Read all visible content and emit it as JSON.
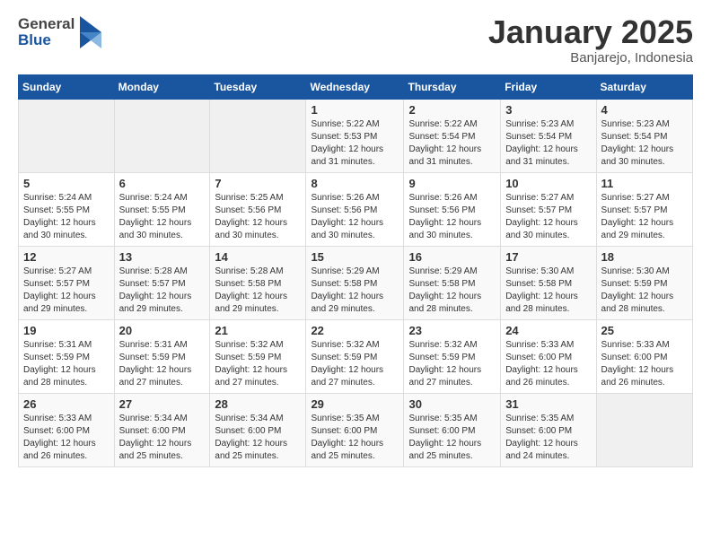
{
  "header": {
    "logo_general": "General",
    "logo_blue": "Blue",
    "month_title": "January 2025",
    "location": "Banjarejo, Indonesia"
  },
  "days_of_week": [
    "Sunday",
    "Monday",
    "Tuesday",
    "Wednesday",
    "Thursday",
    "Friday",
    "Saturday"
  ],
  "weeks": [
    [
      {
        "day": "",
        "sunrise": "",
        "sunset": "",
        "daylight": ""
      },
      {
        "day": "",
        "sunrise": "",
        "sunset": "",
        "daylight": ""
      },
      {
        "day": "",
        "sunrise": "",
        "sunset": "",
        "daylight": ""
      },
      {
        "day": "1",
        "sunrise": "Sunrise: 5:22 AM",
        "sunset": "Sunset: 5:53 PM",
        "daylight": "Daylight: 12 hours and 31 minutes."
      },
      {
        "day": "2",
        "sunrise": "Sunrise: 5:22 AM",
        "sunset": "Sunset: 5:54 PM",
        "daylight": "Daylight: 12 hours and 31 minutes."
      },
      {
        "day": "3",
        "sunrise": "Sunrise: 5:23 AM",
        "sunset": "Sunset: 5:54 PM",
        "daylight": "Daylight: 12 hours and 31 minutes."
      },
      {
        "day": "4",
        "sunrise": "Sunrise: 5:23 AM",
        "sunset": "Sunset: 5:54 PM",
        "daylight": "Daylight: 12 hours and 30 minutes."
      }
    ],
    [
      {
        "day": "5",
        "sunrise": "Sunrise: 5:24 AM",
        "sunset": "Sunset: 5:55 PM",
        "daylight": "Daylight: 12 hours and 30 minutes."
      },
      {
        "day": "6",
        "sunrise": "Sunrise: 5:24 AM",
        "sunset": "Sunset: 5:55 PM",
        "daylight": "Daylight: 12 hours and 30 minutes."
      },
      {
        "day": "7",
        "sunrise": "Sunrise: 5:25 AM",
        "sunset": "Sunset: 5:56 PM",
        "daylight": "Daylight: 12 hours and 30 minutes."
      },
      {
        "day": "8",
        "sunrise": "Sunrise: 5:26 AM",
        "sunset": "Sunset: 5:56 PM",
        "daylight": "Daylight: 12 hours and 30 minutes."
      },
      {
        "day": "9",
        "sunrise": "Sunrise: 5:26 AM",
        "sunset": "Sunset: 5:56 PM",
        "daylight": "Daylight: 12 hours and 30 minutes."
      },
      {
        "day": "10",
        "sunrise": "Sunrise: 5:27 AM",
        "sunset": "Sunset: 5:57 PM",
        "daylight": "Daylight: 12 hours and 30 minutes."
      },
      {
        "day": "11",
        "sunrise": "Sunrise: 5:27 AM",
        "sunset": "Sunset: 5:57 PM",
        "daylight": "Daylight: 12 hours and 29 minutes."
      }
    ],
    [
      {
        "day": "12",
        "sunrise": "Sunrise: 5:27 AM",
        "sunset": "Sunset: 5:57 PM",
        "daylight": "Daylight: 12 hours and 29 minutes."
      },
      {
        "day": "13",
        "sunrise": "Sunrise: 5:28 AM",
        "sunset": "Sunset: 5:57 PM",
        "daylight": "Daylight: 12 hours and 29 minutes."
      },
      {
        "day": "14",
        "sunrise": "Sunrise: 5:28 AM",
        "sunset": "Sunset: 5:58 PM",
        "daylight": "Daylight: 12 hours and 29 minutes."
      },
      {
        "day": "15",
        "sunrise": "Sunrise: 5:29 AM",
        "sunset": "Sunset: 5:58 PM",
        "daylight": "Daylight: 12 hours and 29 minutes."
      },
      {
        "day": "16",
        "sunrise": "Sunrise: 5:29 AM",
        "sunset": "Sunset: 5:58 PM",
        "daylight": "Daylight: 12 hours and 28 minutes."
      },
      {
        "day": "17",
        "sunrise": "Sunrise: 5:30 AM",
        "sunset": "Sunset: 5:58 PM",
        "daylight": "Daylight: 12 hours and 28 minutes."
      },
      {
        "day": "18",
        "sunrise": "Sunrise: 5:30 AM",
        "sunset": "Sunset: 5:59 PM",
        "daylight": "Daylight: 12 hours and 28 minutes."
      }
    ],
    [
      {
        "day": "19",
        "sunrise": "Sunrise: 5:31 AM",
        "sunset": "Sunset: 5:59 PM",
        "daylight": "Daylight: 12 hours and 28 minutes."
      },
      {
        "day": "20",
        "sunrise": "Sunrise: 5:31 AM",
        "sunset": "Sunset: 5:59 PM",
        "daylight": "Daylight: 12 hours and 27 minutes."
      },
      {
        "day": "21",
        "sunrise": "Sunrise: 5:32 AM",
        "sunset": "Sunset: 5:59 PM",
        "daylight": "Daylight: 12 hours and 27 minutes."
      },
      {
        "day": "22",
        "sunrise": "Sunrise: 5:32 AM",
        "sunset": "Sunset: 5:59 PM",
        "daylight": "Daylight: 12 hours and 27 minutes."
      },
      {
        "day": "23",
        "sunrise": "Sunrise: 5:32 AM",
        "sunset": "Sunset: 5:59 PM",
        "daylight": "Daylight: 12 hours and 27 minutes."
      },
      {
        "day": "24",
        "sunrise": "Sunrise: 5:33 AM",
        "sunset": "Sunset: 6:00 PM",
        "daylight": "Daylight: 12 hours and 26 minutes."
      },
      {
        "day": "25",
        "sunrise": "Sunrise: 5:33 AM",
        "sunset": "Sunset: 6:00 PM",
        "daylight": "Daylight: 12 hours and 26 minutes."
      }
    ],
    [
      {
        "day": "26",
        "sunrise": "Sunrise: 5:33 AM",
        "sunset": "Sunset: 6:00 PM",
        "daylight": "Daylight: 12 hours and 26 minutes."
      },
      {
        "day": "27",
        "sunrise": "Sunrise: 5:34 AM",
        "sunset": "Sunset: 6:00 PM",
        "daylight": "Daylight: 12 hours and 25 minutes."
      },
      {
        "day": "28",
        "sunrise": "Sunrise: 5:34 AM",
        "sunset": "Sunset: 6:00 PM",
        "daylight": "Daylight: 12 hours and 25 minutes."
      },
      {
        "day": "29",
        "sunrise": "Sunrise: 5:35 AM",
        "sunset": "Sunset: 6:00 PM",
        "daylight": "Daylight: 12 hours and 25 minutes."
      },
      {
        "day": "30",
        "sunrise": "Sunrise: 5:35 AM",
        "sunset": "Sunset: 6:00 PM",
        "daylight": "Daylight: 12 hours and 25 minutes."
      },
      {
        "day": "31",
        "sunrise": "Sunrise: 5:35 AM",
        "sunset": "Sunset: 6:00 PM",
        "daylight": "Daylight: 12 hours and 24 minutes."
      },
      {
        "day": "",
        "sunrise": "",
        "sunset": "",
        "daylight": ""
      }
    ]
  ]
}
